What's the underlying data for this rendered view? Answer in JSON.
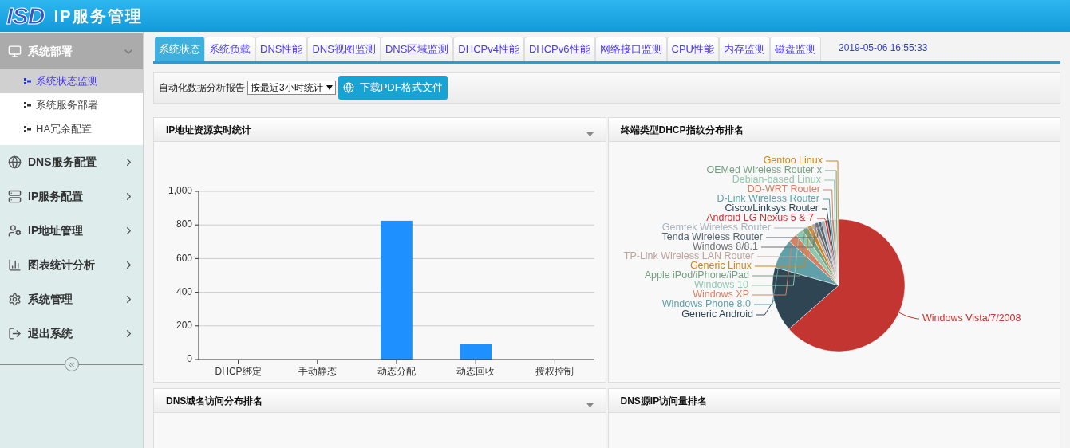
{
  "header": {
    "logo": "ISD",
    "title": "IP服务管理"
  },
  "sidebar": {
    "sections": [
      {
        "label": "系统部署",
        "expanded": true,
        "children": [
          {
            "label": "系统状态监测",
            "selected": true
          },
          {
            "label": "系统服务部署",
            "selected": false
          },
          {
            "label": "HA冗余配置",
            "selected": false
          }
        ]
      },
      {
        "label": "DNS服务配置",
        "expanded": false
      },
      {
        "label": "IP服务配置",
        "expanded": false
      },
      {
        "label": "IP地址管理",
        "expanded": false
      },
      {
        "label": "图表统计分析",
        "expanded": false
      },
      {
        "label": "系统管理",
        "expanded": false
      },
      {
        "label": "退出系统",
        "expanded": false
      }
    ]
  },
  "tabs": [
    {
      "label": "系统状态",
      "selected": true
    },
    {
      "label": "系统负载",
      "selected": false
    },
    {
      "label": "DNS性能",
      "selected": false
    },
    {
      "label": "DNS视图监测",
      "selected": false
    },
    {
      "label": "DNS区域监测",
      "selected": false
    },
    {
      "label": "DHCPv4性能",
      "selected": false
    },
    {
      "label": "DHCPv6性能",
      "selected": false
    },
    {
      "label": "网络接口监测",
      "selected": false
    },
    {
      "label": "CPU性能",
      "selected": false
    },
    {
      "label": "内存监测",
      "selected": false
    },
    {
      "label": "磁盘监测",
      "selected": false
    }
  ],
  "timestamp": "2019-05-06 16:55:33",
  "toolbar": {
    "label": "自动化数据分析报告",
    "select_value": "按最近3小时统计",
    "button": "下载PDF格式文件"
  },
  "panels": [
    {
      "title": "IP地址资源实时统计",
      "menu": true,
      "chart_data": {
        "type": "bar",
        "grid": true,
        "categories": [
          "DHCP绑定",
          "手动静态",
          "动态分配",
          "动态回收",
          "授权控制"
        ],
        "values": [
          0,
          0,
          825,
          92,
          0
        ],
        "ylim": [
          0,
          1000
        ],
        "yticks": [
          0,
          200,
          400,
          600,
          800,
          {
            "value": 1000,
            "label": "1,000"
          }
        ]
      }
    },
    {
      "title": "终端类型DHCP指纹分布排名",
      "menu": false,
      "pie_labels": [
        {
          "label": "Gentoo Linux",
          "color": "#ca8622"
        },
        {
          "label": "OEMed Wireless Router x",
          "color": "#749f83"
        },
        {
          "label": "Debian-based Linux",
          "color": "#91c7ae"
        },
        {
          "label": "DD-WRT Router",
          "color": "#d48265"
        },
        {
          "label": "D-Link Wireless Router",
          "color": "#61a0a8"
        },
        {
          "label": "Cisco/Linksys Router",
          "color": "#2f4554"
        },
        {
          "label": "Android LG Nexus 5 & 7",
          "color": "#c23531"
        },
        {
          "label": "Gemtek Wireless Router",
          "color": "#a9b4be"
        },
        {
          "label": "Tenda Wireless Router",
          "color": "#546570"
        },
        {
          "label": "Windows 8/8.1",
          "color": "#6e7074"
        },
        {
          "label": "TP-Link Wireless LAN Router",
          "color": "#bda29a"
        },
        {
          "label": "Generic Linux",
          "color": "#ca8622"
        },
        {
          "label": "Apple iPod/iPhone/iPad",
          "color": "#749f83"
        },
        {
          "label": "Windows 10",
          "color": "#91c7ae"
        },
        {
          "label": "Windows XP",
          "color": "#d48265"
        },
        {
          "label": "Windows Phone 8.0",
          "color": "#61a0a8"
        },
        {
          "label": "Generic Android",
          "color": "#2f4554"
        },
        {
          "label": "Windows Vista/7/2008",
          "color": "#c23531"
        }
      ]
    },
    {
      "title": "DNS域名访问分布排名",
      "menu": true
    },
    {
      "title": "DNS源IP访问量排名",
      "menu": false
    }
  ]
}
